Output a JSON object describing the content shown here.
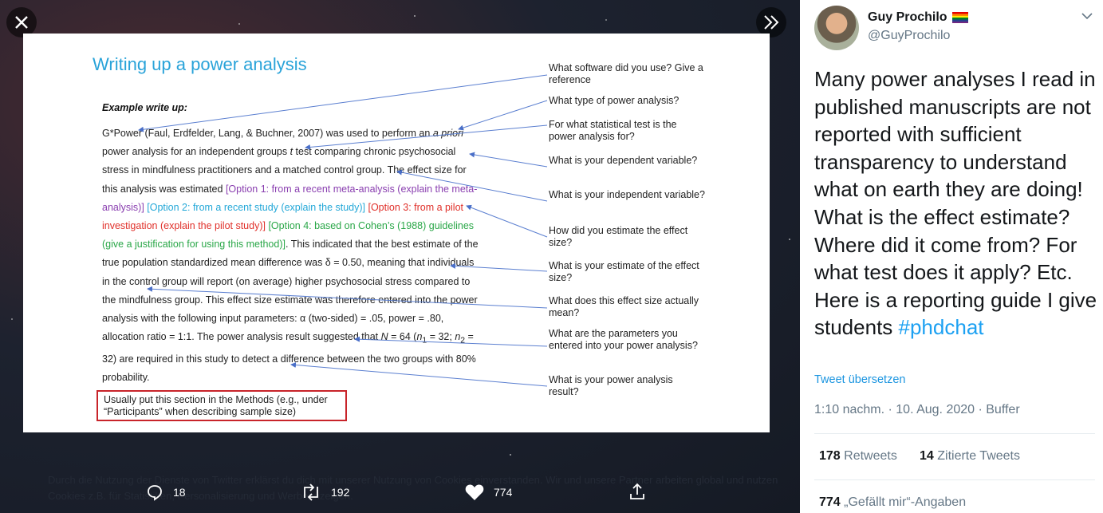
{
  "viewer": {
    "close_icon": "close-icon",
    "expand_icon": "chevron-double-right-icon",
    "slide": {
      "title": "Writing up a power analysis",
      "example_label": "Example write up:",
      "body": {
        "p1": "G*Power (Faul, Erdfelder, Lang, & Buchner, 2007) was used to perform an ",
        "p1_italic": "a priori",
        "p2": " power analysis for an independent groups ",
        "p2_italic": "t",
        "p3": " test comparing chronic psychosocial stress in mindfulness practitioners and a matched control group. The effect size for this analysis was estimated ",
        "opt1": "[Option 1: from a recent meta-analysis (explain the meta-analysis)]",
        "opt2": " [Option 2: from a recent study (explain the study)]",
        "opt3": " [Option 3: from a pilot investigation (explain the pilot study)]",
        "opt4": " [Option 4: based on Cohen’s (1988) guidelines (give a justification for using this method)]",
        "p4": ". This indicated that the best estimate of the true population standardized mean difference was δ = 0.50, meaning that individuals in the control group will report (on average) higher psychosocial stress compared to the mindfulness group. This effect size estimate was therefore entered into the power analysis with the following input parameters: α (two-sided) = .05, power = .80, allocation ratio = 1:1. The power analysis result suggested that ",
        "p4_n": "N",
        "p5": " = 64 (",
        "p5_n1": "n",
        "p5_s1": "1",
        "p6": " = 32; ",
        "p6_n2": "n",
        "p6_s2": "2",
        "p7": " = 32) are required in this study to detect a difference between the two groups with 80% probability."
      },
      "note": "Usually put this section in the Methods (e.g., under “Participants” when describing sample size)",
      "questions": [
        "What software did you use? Give a reference",
        "What type of power analysis?",
        "For what statistical test is the power analysis for?",
        "What is your dependent variable?",
        "What is your independent variable?",
        "How did you estimate the effect size?",
        "What is your estimate of the effect size?",
        "What does this effect size actually mean?",
        "What are the parameters you entered into your power analysis?",
        "What is your power analysis result?"
      ]
    },
    "notice": "Durch die Nutzung der Dienste von Twitter erklärst du dich mit unserer Nutzung von Cookies einverstanden. Wir und unsere Partner arbeiten global und nutzen Cookies z.B. für Statistiken, Personalisierung und Werbeanzeigen.",
    "actions": {
      "replies": "18",
      "retweets": "192",
      "likes": "774"
    }
  },
  "tweet": {
    "name": "Guy Prochilo",
    "handle": "@GuyProchilo",
    "text": "Many power analyses I read in published manuscripts are not reported with sufficient transparency to understand what on earth they are doing! What is the effect estimate? Where did it come from? For what test does it apply? Etc. Here is a reporting guide I give students ",
    "hashtag": "#phdchat",
    "translate": "Tweet übersetzen",
    "timestamp": "1:10 nachm. · 10. Aug. 2020 · Buffer",
    "retweets_count": "178",
    "retweets_label": "Retweets",
    "quotes_count": "14",
    "quotes_label": "Zitierte Tweets",
    "likes_count": "774",
    "likes_label": "„Gefällt mir“-Angaben"
  },
  "colors": {
    "title_blue": "#29a3d9",
    "option1": "#8a3fb0",
    "option2": "#24a8d8",
    "option3": "#e0302a",
    "option4": "#2aa748",
    "note_border": "#c8242a",
    "link_blue": "#1da1f2"
  }
}
